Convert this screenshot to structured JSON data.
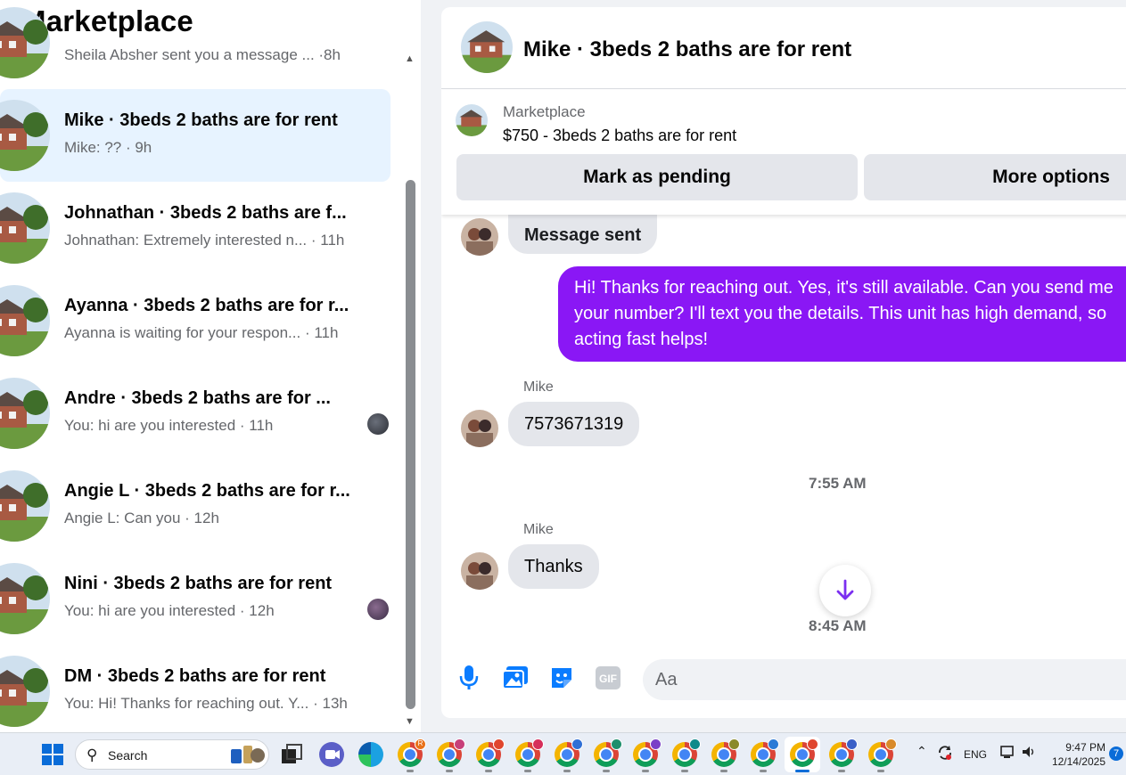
{
  "left_panel": {
    "title": "Marketplace",
    "conversations": [
      {
        "title": "",
        "subtitle": "Sheila Absher sent you a message ... ·8h"
      },
      {
        "title": "Mike · 3beds 2 baths are for rent",
        "subtitle": "Mike: ?? · 9h"
      },
      {
        "title": "Johnathan · 3beds 2 baths are f...",
        "subtitle": "Johnathan: Extremely interested n... · 11h"
      },
      {
        "title": "Ayanna · 3beds 2 baths are for r...",
        "subtitle": "Ayanna is waiting for your respon... · 11h"
      },
      {
        "title": "Andre · 3beds 2 baths are for ...",
        "subtitle": "You: hi are you interested · 11h"
      },
      {
        "title": "Angie L · 3beds 2 baths are for r...",
        "subtitle": "Angie L: Can you · 12h"
      },
      {
        "title": "Nini · 3beds 2 baths are for rent",
        "subtitle": "You: hi are you interested · 12h"
      },
      {
        "title": "DM · 3beds 2 baths are for rent",
        "subtitle": "You: Hi! Thanks for reaching out. Y... · 13h"
      }
    ]
  },
  "chat": {
    "header_title": "Mike · 3beds 2 baths are for rent",
    "listing": {
      "label": "Marketplace",
      "price_title": "$750 - 3beds 2 baths are for rent",
      "mark_pending_label": "Mark as pending",
      "more_options_label": "More options"
    },
    "messages": {
      "partial_bubble": "Message sent",
      "outgoing": "Hi! Thanks for reaching out. Yes, it's still available. Can you send me your number? I'll text you the details. This unit has high demand, so acting fast helps!",
      "sender_1": "Mike",
      "incoming_1": "7573671319",
      "time_1": "7:55 AM",
      "sender_2": "Mike",
      "incoming_2": "Thanks",
      "time_2": "8:45 AM"
    },
    "composer": {
      "placeholder": "Aa",
      "tools": [
        "microphone-icon",
        "photo-icon",
        "sticker-icon",
        "gif-icon"
      ],
      "gif_label": "GIF"
    }
  },
  "taskbar": {
    "search_label": "Search",
    "language": "ENG",
    "time": "9:47 PM",
    "date": "12/14/2025",
    "notification_count": "7",
    "chrome_profiles": [
      "R",
      "",
      "",
      "",
      "",
      "",
      "",
      "",
      "",
      "",
      "",
      ""
    ]
  },
  "colors": {
    "accent_purple": "#8a17f5",
    "active_row": "#e7f3ff",
    "button_gray": "#e4e6eb",
    "windows_blue": "#0a6cd8"
  }
}
